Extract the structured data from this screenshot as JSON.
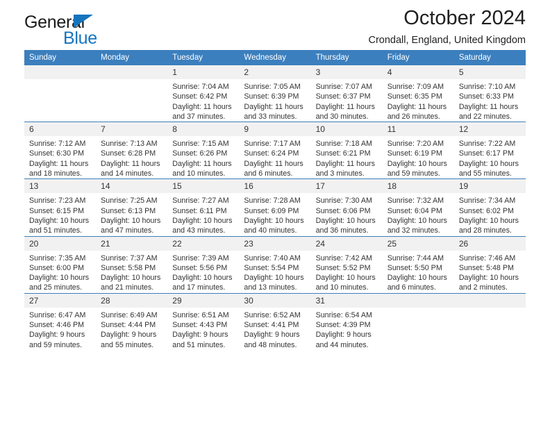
{
  "brand": {
    "name_top": "General",
    "name_bottom": "Blue",
    "accent_color": "#1674bd"
  },
  "header": {
    "title": "October 2024",
    "subtitle": "Crondall, England, United Kingdom"
  },
  "theme": {
    "header_bg": "#3c7fbe",
    "daynum_bg": "#f1f1f1",
    "text": "#333333"
  },
  "calendar": {
    "weekday_headers": [
      "Sunday",
      "Monday",
      "Tuesday",
      "Wednesday",
      "Thursday",
      "Friday",
      "Saturday"
    ],
    "labels": {
      "sunrise": "Sunrise:",
      "sunset": "Sunset:",
      "daylight": "Daylight:"
    },
    "weeks": [
      [
        {
          "day": "",
          "empty": true
        },
        {
          "day": "",
          "empty": true
        },
        {
          "day": "1",
          "sunrise": "Sunrise: 7:04 AM",
          "sunset": "Sunset: 6:42 PM",
          "daylight_1": "Daylight: 11 hours",
          "daylight_2": "and 37 minutes."
        },
        {
          "day": "2",
          "sunrise": "Sunrise: 7:05 AM",
          "sunset": "Sunset: 6:39 PM",
          "daylight_1": "Daylight: 11 hours",
          "daylight_2": "and 33 minutes."
        },
        {
          "day": "3",
          "sunrise": "Sunrise: 7:07 AM",
          "sunset": "Sunset: 6:37 PM",
          "daylight_1": "Daylight: 11 hours",
          "daylight_2": "and 30 minutes."
        },
        {
          "day": "4",
          "sunrise": "Sunrise: 7:09 AM",
          "sunset": "Sunset: 6:35 PM",
          "daylight_1": "Daylight: 11 hours",
          "daylight_2": "and 26 minutes."
        },
        {
          "day": "5",
          "sunrise": "Sunrise: 7:10 AM",
          "sunset": "Sunset: 6:33 PM",
          "daylight_1": "Daylight: 11 hours",
          "daylight_2": "and 22 minutes."
        }
      ],
      [
        {
          "day": "6",
          "sunrise": "Sunrise: 7:12 AM",
          "sunset": "Sunset: 6:30 PM",
          "daylight_1": "Daylight: 11 hours",
          "daylight_2": "and 18 minutes."
        },
        {
          "day": "7",
          "sunrise": "Sunrise: 7:13 AM",
          "sunset": "Sunset: 6:28 PM",
          "daylight_1": "Daylight: 11 hours",
          "daylight_2": "and 14 minutes."
        },
        {
          "day": "8",
          "sunrise": "Sunrise: 7:15 AM",
          "sunset": "Sunset: 6:26 PM",
          "daylight_1": "Daylight: 11 hours",
          "daylight_2": "and 10 minutes."
        },
        {
          "day": "9",
          "sunrise": "Sunrise: 7:17 AM",
          "sunset": "Sunset: 6:24 PM",
          "daylight_1": "Daylight: 11 hours",
          "daylight_2": "and 6 minutes."
        },
        {
          "day": "10",
          "sunrise": "Sunrise: 7:18 AM",
          "sunset": "Sunset: 6:21 PM",
          "daylight_1": "Daylight: 11 hours",
          "daylight_2": "and 3 minutes."
        },
        {
          "day": "11",
          "sunrise": "Sunrise: 7:20 AM",
          "sunset": "Sunset: 6:19 PM",
          "daylight_1": "Daylight: 10 hours",
          "daylight_2": "and 59 minutes."
        },
        {
          "day": "12",
          "sunrise": "Sunrise: 7:22 AM",
          "sunset": "Sunset: 6:17 PM",
          "daylight_1": "Daylight: 10 hours",
          "daylight_2": "and 55 minutes."
        }
      ],
      [
        {
          "day": "13",
          "sunrise": "Sunrise: 7:23 AM",
          "sunset": "Sunset: 6:15 PM",
          "daylight_1": "Daylight: 10 hours",
          "daylight_2": "and 51 minutes."
        },
        {
          "day": "14",
          "sunrise": "Sunrise: 7:25 AM",
          "sunset": "Sunset: 6:13 PM",
          "daylight_1": "Daylight: 10 hours",
          "daylight_2": "and 47 minutes."
        },
        {
          "day": "15",
          "sunrise": "Sunrise: 7:27 AM",
          "sunset": "Sunset: 6:11 PM",
          "daylight_1": "Daylight: 10 hours",
          "daylight_2": "and 43 minutes."
        },
        {
          "day": "16",
          "sunrise": "Sunrise: 7:28 AM",
          "sunset": "Sunset: 6:09 PM",
          "daylight_1": "Daylight: 10 hours",
          "daylight_2": "and 40 minutes."
        },
        {
          "day": "17",
          "sunrise": "Sunrise: 7:30 AM",
          "sunset": "Sunset: 6:06 PM",
          "daylight_1": "Daylight: 10 hours",
          "daylight_2": "and 36 minutes."
        },
        {
          "day": "18",
          "sunrise": "Sunrise: 7:32 AM",
          "sunset": "Sunset: 6:04 PM",
          "daylight_1": "Daylight: 10 hours",
          "daylight_2": "and 32 minutes."
        },
        {
          "day": "19",
          "sunrise": "Sunrise: 7:34 AM",
          "sunset": "Sunset: 6:02 PM",
          "daylight_1": "Daylight: 10 hours",
          "daylight_2": "and 28 minutes."
        }
      ],
      [
        {
          "day": "20",
          "sunrise": "Sunrise: 7:35 AM",
          "sunset": "Sunset: 6:00 PM",
          "daylight_1": "Daylight: 10 hours",
          "daylight_2": "and 25 minutes."
        },
        {
          "day": "21",
          "sunrise": "Sunrise: 7:37 AM",
          "sunset": "Sunset: 5:58 PM",
          "daylight_1": "Daylight: 10 hours",
          "daylight_2": "and 21 minutes."
        },
        {
          "day": "22",
          "sunrise": "Sunrise: 7:39 AM",
          "sunset": "Sunset: 5:56 PM",
          "daylight_1": "Daylight: 10 hours",
          "daylight_2": "and 17 minutes."
        },
        {
          "day": "23",
          "sunrise": "Sunrise: 7:40 AM",
          "sunset": "Sunset: 5:54 PM",
          "daylight_1": "Daylight: 10 hours",
          "daylight_2": "and 13 minutes."
        },
        {
          "day": "24",
          "sunrise": "Sunrise: 7:42 AM",
          "sunset": "Sunset: 5:52 PM",
          "daylight_1": "Daylight: 10 hours",
          "daylight_2": "and 10 minutes."
        },
        {
          "day": "25",
          "sunrise": "Sunrise: 7:44 AM",
          "sunset": "Sunset: 5:50 PM",
          "daylight_1": "Daylight: 10 hours",
          "daylight_2": "and 6 minutes."
        },
        {
          "day": "26",
          "sunrise": "Sunrise: 7:46 AM",
          "sunset": "Sunset: 5:48 PM",
          "daylight_1": "Daylight: 10 hours",
          "daylight_2": "and 2 minutes."
        }
      ],
      [
        {
          "day": "27",
          "sunrise": "Sunrise: 6:47 AM",
          "sunset": "Sunset: 4:46 PM",
          "daylight_1": "Daylight: 9 hours",
          "daylight_2": "and 59 minutes."
        },
        {
          "day": "28",
          "sunrise": "Sunrise: 6:49 AM",
          "sunset": "Sunset: 4:44 PM",
          "daylight_1": "Daylight: 9 hours",
          "daylight_2": "and 55 minutes."
        },
        {
          "day": "29",
          "sunrise": "Sunrise: 6:51 AM",
          "sunset": "Sunset: 4:43 PM",
          "daylight_1": "Daylight: 9 hours",
          "daylight_2": "and 51 minutes."
        },
        {
          "day": "30",
          "sunrise": "Sunrise: 6:52 AM",
          "sunset": "Sunset: 4:41 PM",
          "daylight_1": "Daylight: 9 hours",
          "daylight_2": "and 48 minutes."
        },
        {
          "day": "31",
          "sunrise": "Sunrise: 6:54 AM",
          "sunset": "Sunset: 4:39 PM",
          "daylight_1": "Daylight: 9 hours",
          "daylight_2": "and 44 minutes."
        },
        {
          "day": "",
          "empty": true
        },
        {
          "day": "",
          "empty": true
        }
      ]
    ]
  }
}
